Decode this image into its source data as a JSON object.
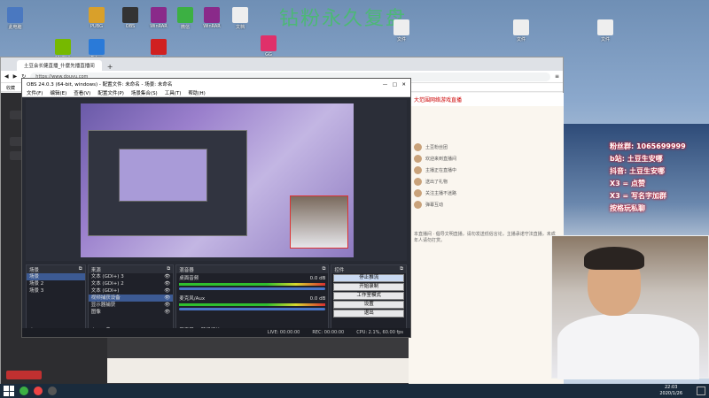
{
  "watermark": "钻粉永久复盘",
  "desktop_icons": [
    {
      "label": "此电脑",
      "color": "#4a78c0"
    },
    {
      "label": "PUBG",
      "color": "#d9a02a"
    },
    {
      "label": "OBS",
      "color": "#333333"
    },
    {
      "label": "WinRAR",
      "color": "#8a2a8a"
    },
    {
      "label": "微信",
      "color": "#3cb043"
    },
    {
      "label": "WinRAR",
      "color": "#8a2a8a"
    },
    {
      "label": "文档",
      "color": "#eeeeee"
    },
    {
      "label": "NVIDIA",
      "color": "#76b900"
    },
    {
      "label": "Edge",
      "color": "#2a7ad8"
    },
    {
      "label": "腾讯",
      "color": "#d02020"
    },
    {
      "label": "GG",
      "color": "#e0306a"
    },
    {
      "label": "文件",
      "color": "#eeeeee"
    },
    {
      "label": "文件",
      "color": "#eeeeee"
    },
    {
      "label": "文件",
      "color": "#eeeeee"
    }
  ],
  "browser": {
    "tab_title": "土豆会长健直播_什麼先播直播间",
    "address": "https://www.douyu.com",
    "bookmarks": "收藏",
    "right_tab": "大范围网络游戏直播",
    "chat": [
      "土豆粉丝团",
      "欢迎来到直播间",
      "主播正在直播中",
      "送出了礼物",
      "关注主播不迷路",
      "弹幕互动"
    ],
    "notice": "本直播间 · 倡导文明直播，请勿发送低俗言论，主播承诺守法直播，未成年人请勿打赏。"
  },
  "obs": {
    "title": "OBS 24.0.3 (64-bit, windows) - 配置文件: 未命名 - 场景: 未命名",
    "menu": [
      "文件(F)",
      "编辑(E)",
      "查看(V)",
      "配置文件(P)",
      "场景集合(S)",
      "工具(T)",
      "帮助(H)"
    ],
    "scenes_title": "场景",
    "scenes": [
      "场景",
      "场景 2",
      "场景 3"
    ],
    "sources_title": "来源",
    "sources": [
      "文本 (GDI+) 3",
      "文本 (GDI+) 2",
      "文本 (GDI+)",
      "视频捕获设备",
      "显示器捕获",
      "图像"
    ],
    "mixer_title": "混音器",
    "mixer": [
      {
        "name": "桌面音频",
        "db": "0.0 dB"
      },
      {
        "name": "麦克风/Aux",
        "db": "0.0 dB"
      }
    ],
    "mixer_tabs": [
      "混音器",
      "转场特效"
    ],
    "controls_title": "控件",
    "controls": [
      "停止推流",
      "开始录制",
      "工作室模式",
      "设置",
      "退出"
    ],
    "status": {
      "live": "LIVE: 00:00:00",
      "rec": "REC: 00:00:00",
      "cpu": "CPU: 2.1%, 60.00 fps"
    }
  },
  "overlay": [
    "粉丝群: 1065699999",
    "b站: 土豆生安哪",
    "抖音: 土豆生安哪",
    "X3 = 点赞",
    "X3 = 写名字加群",
    "按格玩私聊"
  ],
  "taskbar": {
    "time": "22:03",
    "date": "2020/1/26"
  }
}
